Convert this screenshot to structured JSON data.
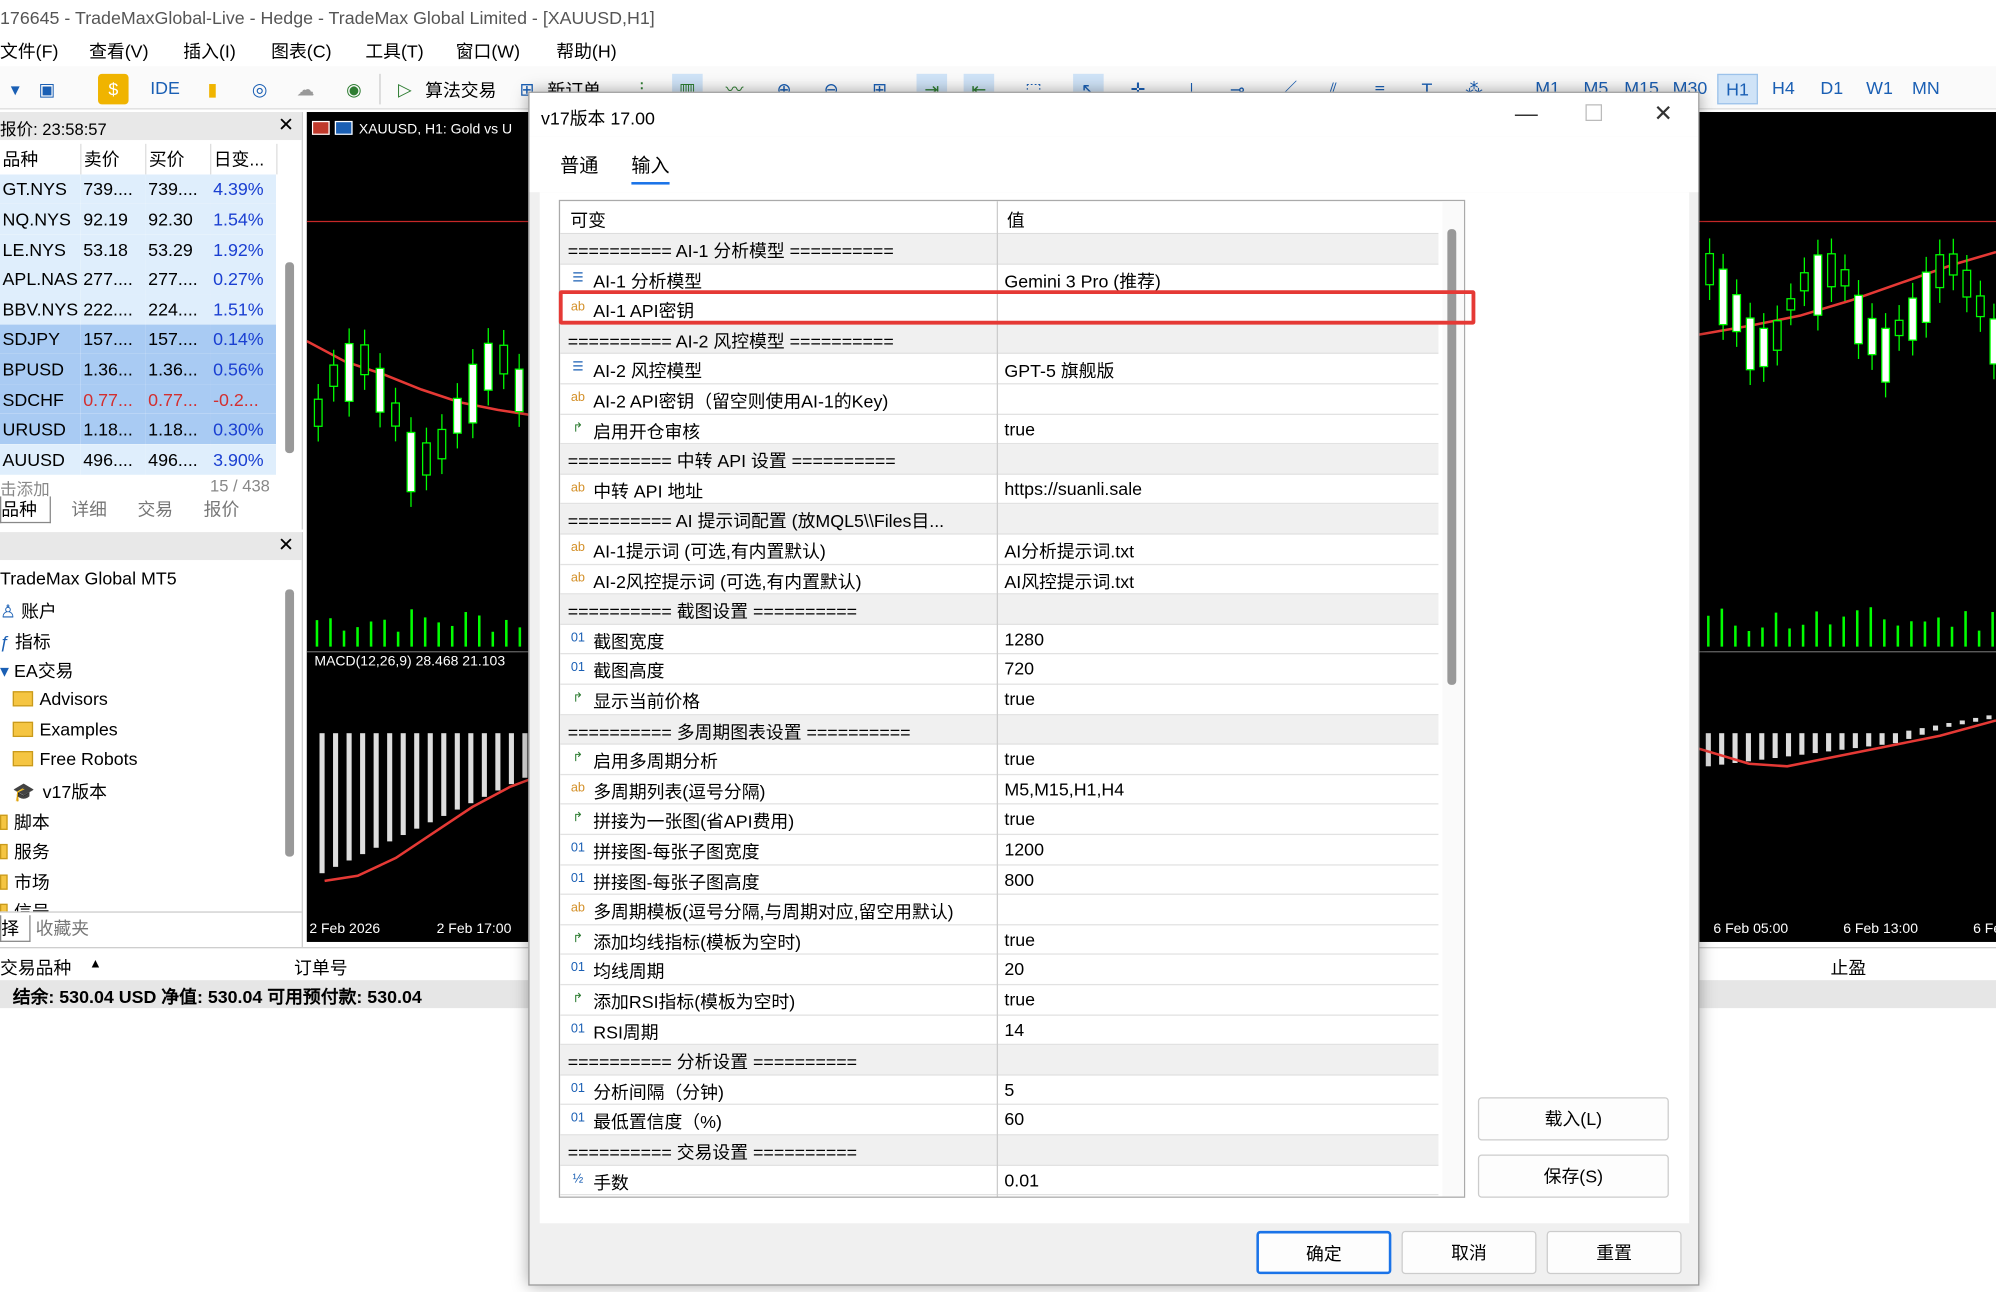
{
  "window_title": "176645 - TradeMaxGlobal-Live - Hedge - TradeMax Global Limited - [XAUUSD,H1]",
  "menu": [
    "文件(F)",
    "查看(V)",
    "插入(I)",
    "图表(C)",
    "工具(T)",
    "窗口(W)",
    "帮助(H)"
  ],
  "toolbar": {
    "ide": "IDE",
    "algo": "算法交易",
    "new_order": "新订单",
    "timeframes": [
      "M1",
      "M5",
      "M15",
      "M30",
      "H1",
      "H4",
      "D1",
      "W1",
      "MN"
    ],
    "active_tf": "H1"
  },
  "market_watch": {
    "title": "报价: 23:58:57",
    "headers": [
      "品种",
      "卖价",
      "买价",
      "日变..."
    ],
    "rows": [
      {
        "sym": "GT.NYS",
        "bid": "739....",
        "ask": "739....",
        "chg": "4.39%",
        "color": "blue",
        "hl": false
      },
      {
        "sym": "NQ.NYS",
        "bid": "92.19",
        "ask": "92.30",
        "chg": "1.54%",
        "color": "blue",
        "hl": false
      },
      {
        "sym": "LE.NYS",
        "bid": "53.18",
        "ask": "53.29",
        "chg": "1.92%",
        "color": "blue",
        "hl": false
      },
      {
        "sym": "APL.NAS",
        "bid": "277....",
        "ask": "277....",
        "chg": "0.27%",
        "color": "blue",
        "hl": false
      },
      {
        "sym": "BBV.NYS",
        "bid": "222....",
        "ask": "224....",
        "chg": "1.51%",
        "color": "blue",
        "hl": false
      },
      {
        "sym": "SDJPY",
        "bid": "157....",
        "ask": "157....",
        "chg": "0.14%",
        "color": "blue",
        "hl": true
      },
      {
        "sym": "BPUSD",
        "bid": "1.36...",
        "ask": "1.36...",
        "chg": "0.56%",
        "color": "blue",
        "hl": true
      },
      {
        "sym": "SDCHF",
        "bid": "0.77...",
        "ask": "0.77...",
        "chg": "-0.2...",
        "color": "red",
        "hl": true
      },
      {
        "sym": "URUSD",
        "bid": "1.18...",
        "ask": "1.18...",
        "chg": "0.30%",
        "color": "blue",
        "hl": true
      },
      {
        "sym": "AUUSD",
        "bid": "496....",
        "ask": "496....",
        "chg": "3.90%",
        "color": "blue",
        "hl": false
      }
    ],
    "footer_left": "击添加",
    "footer_count": "15 / 438",
    "tabs": [
      "品种",
      "详细",
      "交易",
      "报价"
    ]
  },
  "navigator": {
    "root": "TradeMax Global MT5",
    "items": [
      "账户",
      "指标",
      "EA交易",
      "Advisors",
      "Examples",
      "Free Robots",
      "v17版本",
      "脚本",
      "服务",
      "市场",
      "信号"
    ],
    "tabs": [
      "择",
      "收藏夹"
    ]
  },
  "chart": {
    "tab": "XAUUSD, H1:  Gold vs U",
    "macd": "MACD(12,26,9) 28.468 21.103",
    "dates_left": [
      "2 Feb 2026",
      "2 Feb 17:00"
    ],
    "dates_right": [
      "6 Feb 05:00",
      "6 Feb 13:00",
      "6 Fe"
    ]
  },
  "bottom": {
    "col1": "交易品种",
    "col2": "订单号",
    "col3": "止盈"
  },
  "status": "结余: 530.04 USD  净值: 530.04  可用预付款: 530.04",
  "dialog": {
    "title": "v17版本 17.00",
    "tabs": [
      "普通",
      "输入"
    ],
    "col_var": "可变",
    "col_val": "值",
    "rows": [
      {
        "t": "sec",
        "label": "========== AI-1 分析模型 ==========",
        "value": ""
      },
      {
        "t": "enum",
        "label": "AI-1 分析模型",
        "value": "Gemini 3 Pro (推荐)"
      },
      {
        "t": "ab",
        "label": "AI-1 API密钥",
        "value": ""
      },
      {
        "t": "sec",
        "label": "========== AI-2 风控模型 ==========",
        "value": ""
      },
      {
        "t": "enum",
        "label": "AI-2 风控模型",
        "value": "GPT-5 旗舰版"
      },
      {
        "t": "ab",
        "label": "AI-2 API密钥（留空则使用AI-1的Key)",
        "value": ""
      },
      {
        "t": "bool",
        "label": "启用开仓审核",
        "value": "true"
      },
      {
        "t": "sec",
        "label": "========== 中转 API 设置 ==========",
        "value": ""
      },
      {
        "t": "ab",
        "label": "中转 API 地址",
        "value": "https://suanli.sale"
      },
      {
        "t": "sec",
        "label": "========== AI 提示词配置 (放MQL5\\\\Files目...",
        "value": ""
      },
      {
        "t": "ab",
        "label": "AI-1提示词 (可选,有内置默认)",
        "value": "AI分析提示词.txt"
      },
      {
        "t": "ab",
        "label": "AI-2风控提示词 (可选,有内置默认)",
        "value": "AI风控提示词.txt"
      },
      {
        "t": "sec",
        "label": "========== 截图设置 ==========",
        "value": ""
      },
      {
        "t": "int",
        "label": "截图宽度",
        "value": "1280"
      },
      {
        "t": "int",
        "label": "截图高度",
        "value": "720"
      },
      {
        "t": "bool",
        "label": "显示当前价格",
        "value": "true"
      },
      {
        "t": "sec",
        "label": "========== 多周期图表设置 ==========",
        "value": ""
      },
      {
        "t": "bool",
        "label": "启用多周期分析",
        "value": "true"
      },
      {
        "t": "ab",
        "label": "多周期列表(逗号分隔)",
        "value": "M5,M15,H1,H4"
      },
      {
        "t": "bool",
        "label": "拼接为一张图(省API费用)",
        "value": "true"
      },
      {
        "t": "int",
        "label": "拼接图-每张子图宽度",
        "value": "1200"
      },
      {
        "t": "int",
        "label": "拼接图-每张子图高度",
        "value": "800"
      },
      {
        "t": "ab",
        "label": "多周期模板(逗号分隔,与周期对应,留空用默认)",
        "value": ""
      },
      {
        "t": "bool",
        "label": "添加均线指标(模板为空时)",
        "value": "true"
      },
      {
        "t": "int",
        "label": "均线周期",
        "value": "20"
      },
      {
        "t": "bool",
        "label": "添加RSI指标(模板为空时)",
        "value": "true"
      },
      {
        "t": "int",
        "label": "RSI周期",
        "value": "14"
      },
      {
        "t": "sec",
        "label": "========== 分析设置 ==========",
        "value": ""
      },
      {
        "t": "int",
        "label": "分析间隔（分钟)",
        "value": "5"
      },
      {
        "t": "int",
        "label": "最低置信度（%)",
        "value": "60"
      },
      {
        "t": "sec",
        "label": "========== 交易设置 ==========",
        "value": ""
      },
      {
        "t": "dbl",
        "label": "手数",
        "value": "0.01"
      }
    ],
    "icons": {
      "enum": "☰",
      "ab": "ab",
      "bool": "↱",
      "int": "01",
      "dbl": "½"
    },
    "load": "载入(L)",
    "save": "保存(S)",
    "ok": "确定",
    "cancel": "取消",
    "reset": "重置"
  }
}
